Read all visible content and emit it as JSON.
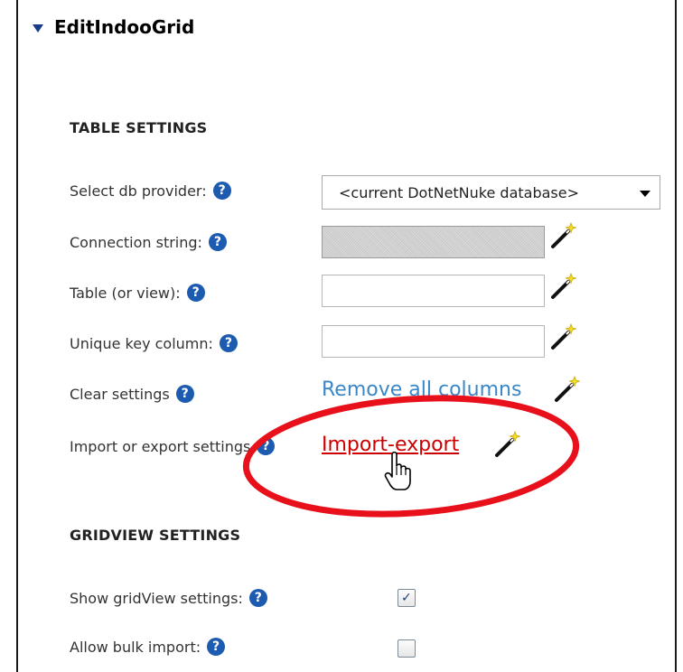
{
  "module": {
    "title": "EditIndooGrid"
  },
  "table_settings": {
    "heading": "TABLE SETTINGS",
    "rows": [
      {
        "label": "Select db provider:"
      },
      {
        "label": "Connection string:"
      },
      {
        "label": "Table (or view):"
      },
      {
        "label": "Unique key column:"
      },
      {
        "label": "Clear settings"
      },
      {
        "label": "Import or export settings"
      }
    ],
    "db_provider_value": "<current DotNetNuke database>",
    "connection_string_value": "",
    "table_value": "",
    "unique_key_value": "",
    "remove_columns_link": "Remove all columns",
    "import_export_link": "Import-export"
  },
  "gridview_settings": {
    "heading": "GRIDVIEW SETTINGS",
    "rows": [
      {
        "label": "Show gridView settings:",
        "checked": true
      },
      {
        "label": "Allow bulk import:",
        "checked": false
      }
    ]
  },
  "icons": {
    "help": "question-icon",
    "wand": "wand-icon",
    "cursor": "hand-cursor-icon"
  },
  "colors": {
    "link_blue": "#3a87c8",
    "link_red": "#cc0000",
    "highlight_ellipse": "#e8101a",
    "help_icon": "#1c5bb0"
  }
}
